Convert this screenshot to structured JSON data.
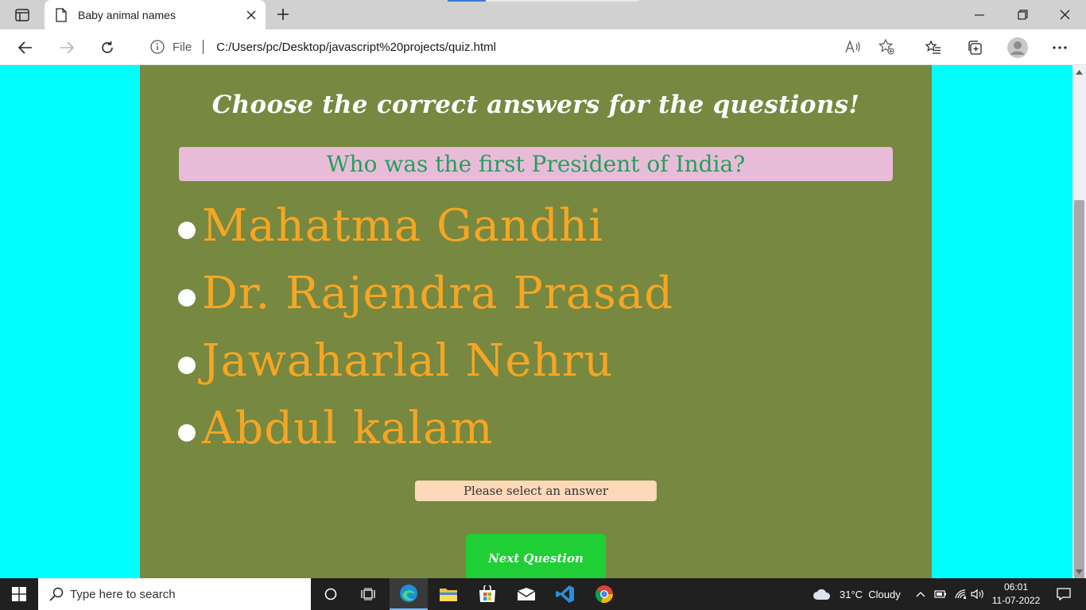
{
  "browser": {
    "tab_title": "Baby animal names",
    "address_protocol": "File",
    "address_url": "C:/Users/pc/Desktop/javascript%20projects/quiz.html"
  },
  "quiz": {
    "heading": "Choose the correct answers for the questions!",
    "question": "Who was the first President of India?",
    "answers": [
      "Mahatma Gandhi",
      "Dr. Rajendra Prasad",
      "Jawaharlal Nehru",
      "Abdul kalam"
    ],
    "message": "Please select an answer",
    "next_button": "Next Question"
  },
  "colors": {
    "page_bg": "#00ffff",
    "quiz_bg": "#778840",
    "question_bg": "#e8bcd9",
    "question_text": "#23a05a",
    "answer_text": "#f5a623",
    "message_bg": "#fdd8b9",
    "next_button_bg": "#1fcf35"
  },
  "taskbar": {
    "search_placeholder": "Type here to search",
    "weather": "31°C  Cloudy",
    "time": "06:01",
    "date": "11-07-2022"
  }
}
